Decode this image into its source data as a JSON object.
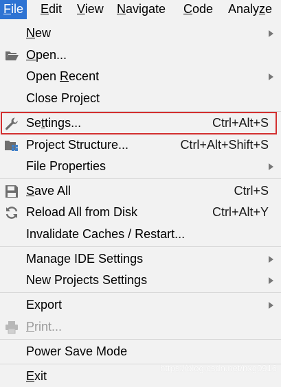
{
  "menubar": {
    "items": [
      {
        "mnemonic": "F",
        "rest": "ile"
      },
      {
        "mnemonic": "E",
        "rest": "dit"
      },
      {
        "mnemonic": "V",
        "rest": "iew"
      },
      {
        "mnemonic": "N",
        "rest": "avigate"
      },
      {
        "mnemonic": "C",
        "rest": "ode"
      },
      {
        "pre": "Analy",
        "mnemonic": "z",
        "rest": "e"
      }
    ]
  },
  "file_menu": {
    "new": {
      "mnemonic": "N",
      "rest": "ew"
    },
    "open": {
      "mnemonic": "O",
      "rest": "pen..."
    },
    "open_recent": {
      "pre": "Open ",
      "mnemonic": "R",
      "rest": "ecent"
    },
    "close_project": {
      "label": "Close Project"
    },
    "settings": {
      "pre": "Se",
      "mnemonic": "t",
      "rest": "tings...",
      "shortcut": "Ctrl+Alt+S"
    },
    "project_structure": {
      "label": "Project Structure...",
      "shortcut": "Ctrl+Alt+Shift+S"
    },
    "file_properties": {
      "label": "File Properties"
    },
    "save_all": {
      "mnemonic": "S",
      "rest": "ave All",
      "shortcut": "Ctrl+S"
    },
    "reload_all": {
      "label": "Reload All from Disk",
      "shortcut": "Ctrl+Alt+Y"
    },
    "invalidate_caches": {
      "label": "Invalidate Caches / Restart..."
    },
    "manage_ide_settings": {
      "label": "Manage IDE Settings"
    },
    "new_projects_settings": {
      "label": "New Projects Settings"
    },
    "export": {
      "label": "Export"
    },
    "print": {
      "mnemonic": "P",
      "rest": "rint..."
    },
    "power_save_mode": {
      "label": "Power Save Mode"
    },
    "exit": {
      "mnemonic": "E",
      "rest": "xit"
    }
  },
  "watermark": "https://blog.csdn.net/nxg0916",
  "colors": {
    "menu_background": "#f2f2f2",
    "active_menubar": "#2e73d3",
    "highlight_border": "#d32f2f",
    "icon_gray": "#6e6e6e",
    "icon_blue": "#3d7fc9"
  },
  "icons": [
    "folder-open-icon",
    "wrench-icon",
    "project-structure-icon",
    "save-icon",
    "reload-icon",
    "printer-icon"
  ]
}
